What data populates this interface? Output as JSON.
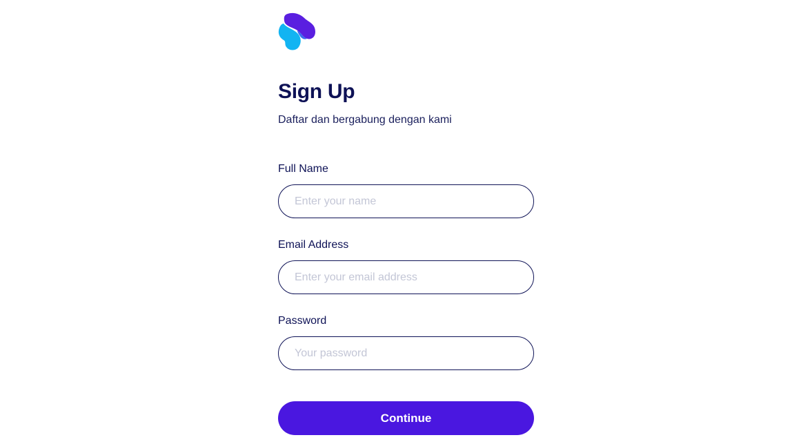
{
  "header": {
    "logo_icon": "brand-s-logo-icon",
    "title": "Sign Up",
    "subtitle": "Daftar dan bergabung dengan kami"
  },
  "form": {
    "full_name": {
      "label": "Full Name",
      "value": "",
      "placeholder": "Enter your name"
    },
    "email": {
      "label": "Email Address",
      "value": "",
      "placeholder": "Enter your email address"
    },
    "password": {
      "label": "Password",
      "value": "",
      "placeholder": "Your password"
    },
    "continue_label": "Continue"
  },
  "colors": {
    "primary": "#4a17e0",
    "logo_purple": "#5a1fe0",
    "logo_cyan": "#12b4f2",
    "text_dark": "#0e1256",
    "placeholder": "#c3c6d6",
    "border": "#0e1256"
  }
}
